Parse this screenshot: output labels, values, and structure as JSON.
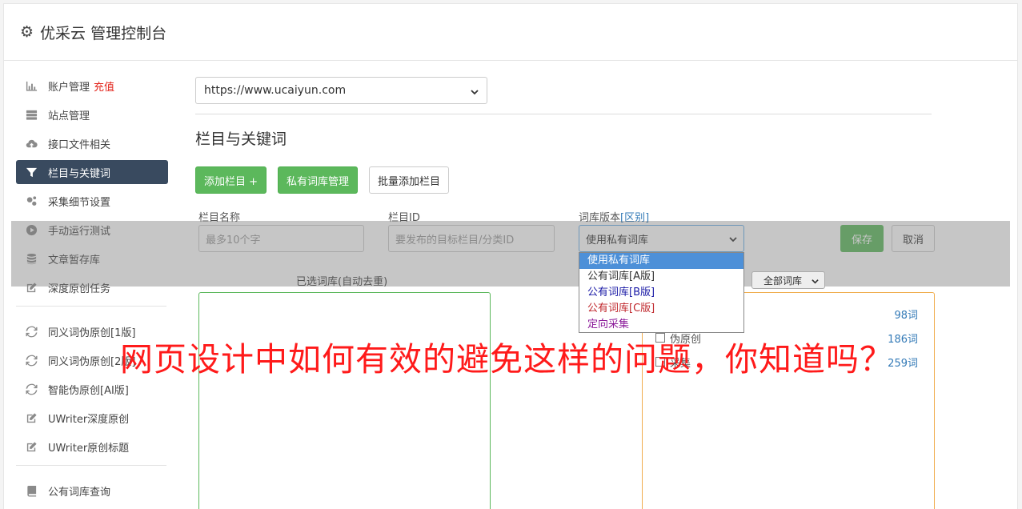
{
  "app": {
    "title": "优采云 管理控制台"
  },
  "sidebar": {
    "items": [
      {
        "label": "账户管理",
        "badge": "充值",
        "icon": "bar-chart-icon"
      },
      {
        "label": "站点管理",
        "icon": "server-icon"
      },
      {
        "label": "接口文件相关",
        "icon": "cloud-upload-icon"
      },
      {
        "label": "栏目与关键词",
        "icon": "filter-icon",
        "active": true
      },
      {
        "label": "采集细节设置",
        "icon": "gears-icon"
      },
      {
        "label": "手动运行测试",
        "icon": "play-circle-icon"
      },
      {
        "label": "文章暂存库",
        "icon": "database-icon"
      },
      {
        "label": "深度原创任务",
        "icon": "edit-icon"
      }
    ],
    "items2": [
      {
        "label": "同义词伪原创[1版]",
        "icon": "refresh-icon"
      },
      {
        "label": "同义词伪原创[2版]",
        "icon": "refresh-icon"
      },
      {
        "label": "智能伪原创[AI版]",
        "icon": "refresh-icon"
      },
      {
        "label": "UWriter深度原创",
        "icon": "edit-icon"
      },
      {
        "label": "UWriter原创标题",
        "icon": "edit-icon"
      }
    ],
    "items3": [
      {
        "label": "公有词库查询",
        "icon": "book-icon"
      }
    ]
  },
  "main": {
    "site_select": "https://www.ucaiyun.com",
    "section_title": "栏目与关键词",
    "buttons": {
      "add_column": "添加栏目 +",
      "private_lib": "私有词库管理",
      "batch_add": "批量添加栏目"
    },
    "form": {
      "name_label": "栏目名称",
      "name_placeholder": "最多10个字",
      "id_label": "栏目ID",
      "id_placeholder": "要发布的目标栏目/分类ID",
      "version_label": "词库版本",
      "version_link": "[区别]",
      "version_value": "使用私有词库",
      "save": "保存",
      "cancel": "取消"
    },
    "dropdown_options": [
      {
        "label": "使用私有词库",
        "color": "#ffffff"
      },
      {
        "label": "公有词库[A版]",
        "color": "#333333"
      },
      {
        "label": "公有词库[B版]",
        "color": "#1a1aa6"
      },
      {
        "label": "公有词库[C版]",
        "color": "#c0282d"
      },
      {
        "label": "定向采集",
        "color": "#8b1a9a"
      }
    ],
    "selected_libs_label": "已选词库(自动去重)",
    "lib_filter": "全部词库",
    "libraries": [
      {
        "name": "",
        "count": "98词"
      },
      {
        "name": "伪原创",
        "count": "186词"
      },
      {
        "name": "采集",
        "count": "259词"
      }
    ]
  },
  "banner": "网页设计中如何有效的避免这样的问题，你知道吗？"
}
